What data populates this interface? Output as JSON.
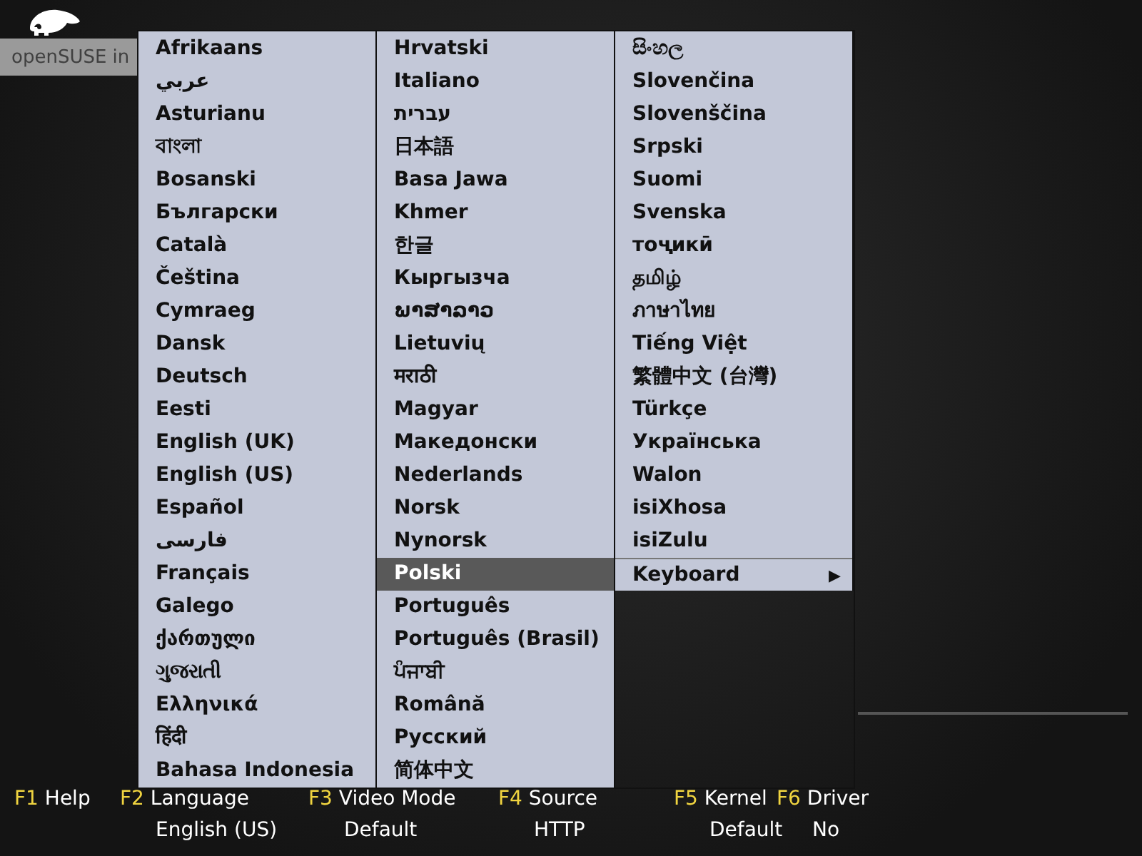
{
  "header": {
    "title": "openSUSE in"
  },
  "language_menu": {
    "columns": [
      [
        {
          "label": "Afrikaans",
          "kind": "language",
          "selected": false
        },
        {
          "label": "عربي",
          "kind": "language",
          "selected": false
        },
        {
          "label": "Asturianu",
          "kind": "language",
          "selected": false
        },
        {
          "label": "বাংলা",
          "kind": "language",
          "selected": false
        },
        {
          "label": "Bosanski",
          "kind": "language",
          "selected": false
        },
        {
          "label": "Български",
          "kind": "language",
          "selected": false
        },
        {
          "label": "Català",
          "kind": "language",
          "selected": false
        },
        {
          "label": "Čeština",
          "kind": "language",
          "selected": false
        },
        {
          "label": "Cymraeg",
          "kind": "language",
          "selected": false
        },
        {
          "label": "Dansk",
          "kind": "language",
          "selected": false
        },
        {
          "label": "Deutsch",
          "kind": "language",
          "selected": false
        },
        {
          "label": "Eesti",
          "kind": "language",
          "selected": false
        },
        {
          "label": "English (UK)",
          "kind": "language",
          "selected": false
        },
        {
          "label": "English (US)",
          "kind": "language",
          "selected": false
        },
        {
          "label": "Español",
          "kind": "language",
          "selected": false
        },
        {
          "label": "فارسی",
          "kind": "language",
          "selected": false
        },
        {
          "label": "Français",
          "kind": "language",
          "selected": false
        },
        {
          "label": "Galego",
          "kind": "language",
          "selected": false
        },
        {
          "label": "ქართული",
          "kind": "language",
          "selected": false
        },
        {
          "label": "ગુજરાતી",
          "kind": "language",
          "selected": false
        },
        {
          "label": "Ελληνικά",
          "kind": "language",
          "selected": false
        },
        {
          "label": "हिंदी",
          "kind": "language",
          "selected": false
        },
        {
          "label": "Bahasa Indonesia",
          "kind": "language",
          "selected": false
        }
      ],
      [
        {
          "label": "Hrvatski",
          "kind": "language",
          "selected": false
        },
        {
          "label": "Italiano",
          "kind": "language",
          "selected": false
        },
        {
          "label": "עברית",
          "kind": "language",
          "selected": false
        },
        {
          "label": "日本語",
          "kind": "language",
          "selected": false
        },
        {
          "label": "Basa Jawa",
          "kind": "language",
          "selected": false
        },
        {
          "label": "Khmer",
          "kind": "language",
          "selected": false
        },
        {
          "label": "한글",
          "kind": "language",
          "selected": false
        },
        {
          "label": "Кыргызча",
          "kind": "language",
          "selected": false
        },
        {
          "label": "ພາສາລາວ",
          "kind": "language",
          "selected": false
        },
        {
          "label": "Lietuvių",
          "kind": "language",
          "selected": false
        },
        {
          "label": "मराठी",
          "kind": "language",
          "selected": false
        },
        {
          "label": "Magyar",
          "kind": "language",
          "selected": false
        },
        {
          "label": "Македонски",
          "kind": "language",
          "selected": false
        },
        {
          "label": "Nederlands",
          "kind": "language",
          "selected": false
        },
        {
          "label": "Norsk",
          "kind": "language",
          "selected": false
        },
        {
          "label": "Nynorsk",
          "kind": "language",
          "selected": false
        },
        {
          "label": "Polski",
          "kind": "language",
          "selected": true
        },
        {
          "label": "Português",
          "kind": "language",
          "selected": false
        },
        {
          "label": "Português (Brasil)",
          "kind": "language",
          "selected": false
        },
        {
          "label": "ਪੰਜਾਬੀ",
          "kind": "language",
          "selected": false
        },
        {
          "label": "Română",
          "kind": "language",
          "selected": false
        },
        {
          "label": "Русский",
          "kind": "language",
          "selected": false
        },
        {
          "label": "简体中文",
          "kind": "language",
          "selected": false
        }
      ],
      [
        {
          "label": "සිංහල",
          "kind": "language",
          "selected": false
        },
        {
          "label": "Slovenčina",
          "kind": "language",
          "selected": false
        },
        {
          "label": "Slovenščina",
          "kind": "language",
          "selected": false
        },
        {
          "label": "Srpski",
          "kind": "language",
          "selected": false
        },
        {
          "label": "Suomi",
          "kind": "language",
          "selected": false
        },
        {
          "label": "Svenska",
          "kind": "language",
          "selected": false
        },
        {
          "label": "тоҷикӣ",
          "kind": "language",
          "selected": false
        },
        {
          "label": "தமிழ்",
          "kind": "language",
          "selected": false
        },
        {
          "label": "ภาษาไทย",
          "kind": "language",
          "selected": false
        },
        {
          "label": "Tiếng Việt",
          "kind": "language",
          "selected": false
        },
        {
          "label": "繁體中文 (台灣)",
          "kind": "language",
          "selected": false
        },
        {
          "label": "Türkçe",
          "kind": "language",
          "selected": false
        },
        {
          "label": "Українська",
          "kind": "language",
          "selected": false
        },
        {
          "label": "Walon",
          "kind": "language",
          "selected": false
        },
        {
          "label": "isiXhosa",
          "kind": "language",
          "selected": false
        },
        {
          "label": "isiZulu",
          "kind": "language",
          "selected": false
        },
        {
          "label": "Keyboard",
          "kind": "submenu",
          "arrow": "▶",
          "selected": false
        }
      ]
    ]
  },
  "function_keys": [
    {
      "key": "F1",
      "label": "Help"
    },
    {
      "key": "F2",
      "label": "Language",
      "value": "English (US)"
    },
    {
      "key": "F3",
      "label": "Video Mode",
      "value": "Default"
    },
    {
      "key": "F4",
      "label": "Source",
      "value": "HTTP"
    },
    {
      "key": "F5",
      "label": "Kernel",
      "value": "Default"
    },
    {
      "key": "F6",
      "label": "Driver",
      "value": "No"
    }
  ]
}
